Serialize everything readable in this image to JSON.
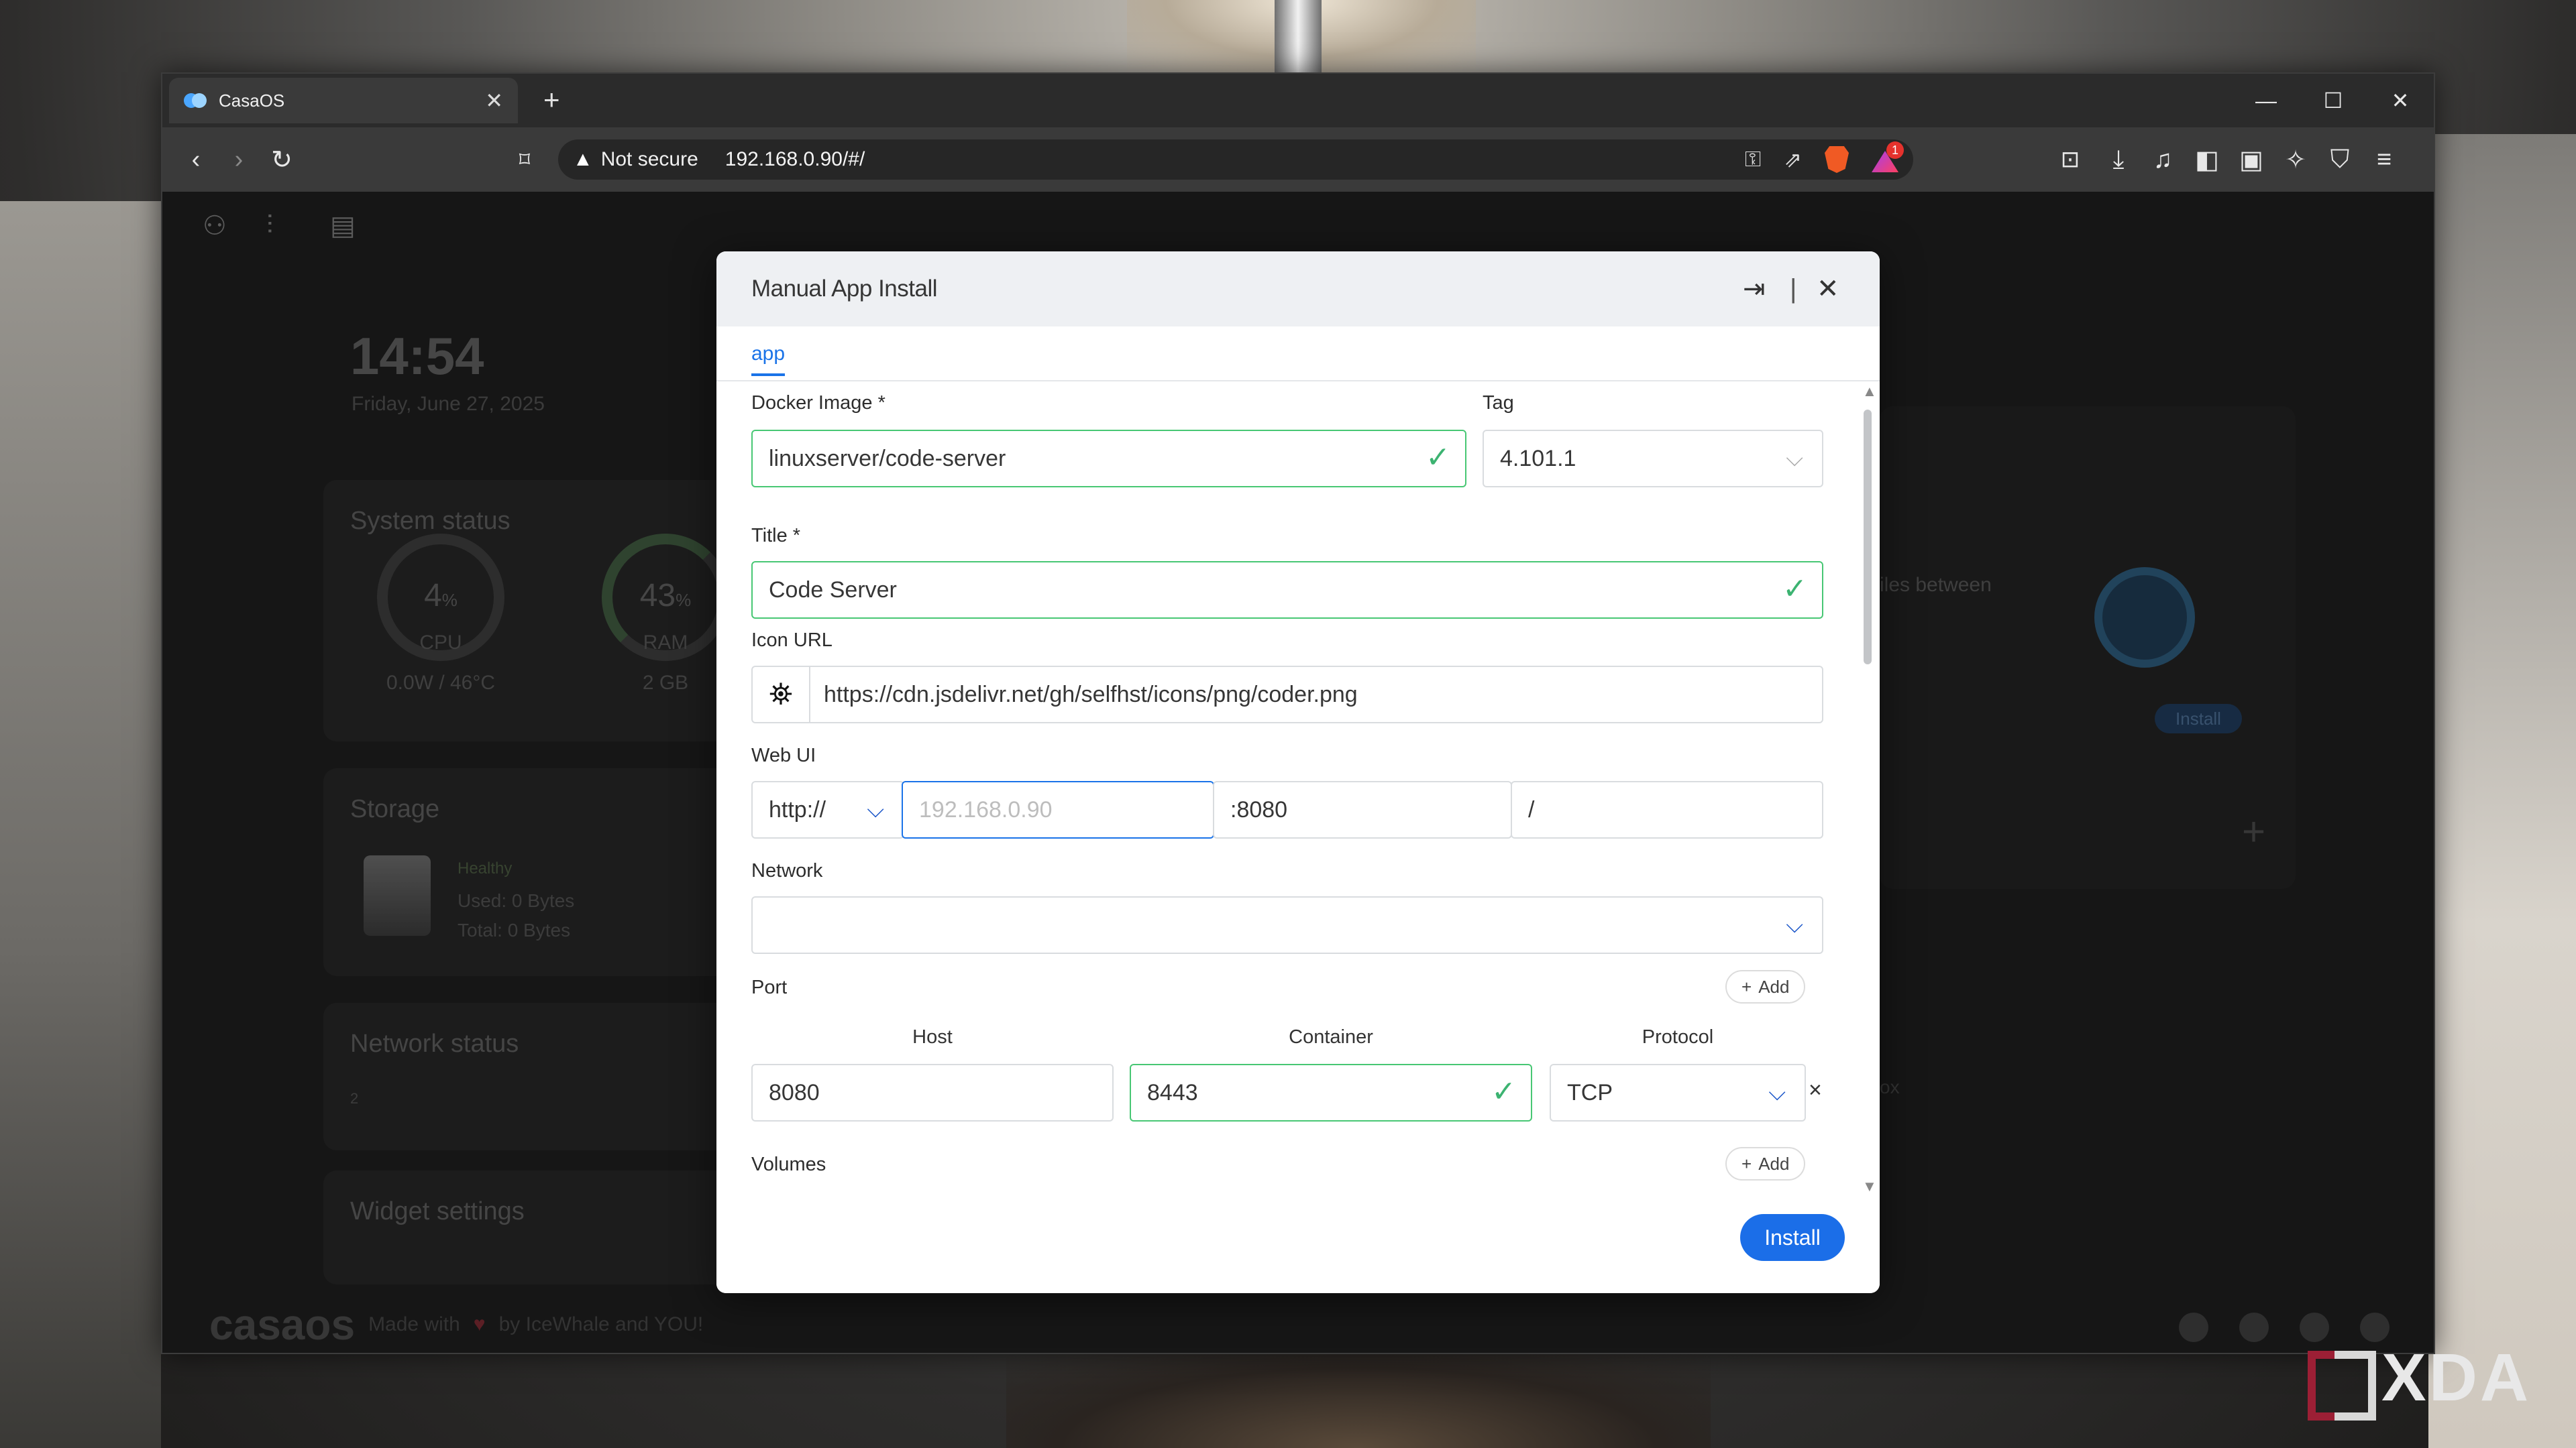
{
  "browser": {
    "tab_title": "CasaOS",
    "new_tab": "+",
    "security_label": "Not secure",
    "url": "192.168.0.90/#/",
    "brave_badge": "1"
  },
  "dashboard": {
    "time": "14:54",
    "date": "Friday, June 27, 2025",
    "system_status_title": "System status",
    "cpu_value": "4",
    "cpu_unit": "%",
    "cpu_label": "CPU",
    "cpu_detail": "0.0W / 46°C",
    "ram_value": "43",
    "ram_unit": "%",
    "ram_label": "RAM",
    "ram_detail": "2 GB",
    "storage_title": "Storage",
    "storage_badge": "Healthy",
    "storage_used": "Used: 0 Bytes",
    "storage_total": "Total: 0 Bytes",
    "network_title": "Network status",
    "network_axis": "2",
    "widget_title": "Widget settings",
    "app_desc_fragment": "iles between",
    "app_install_button": "Install",
    "app_fragment2": "ox",
    "footer_logo": "casaos",
    "footer_made_with": "Made with",
    "footer_by": "by IceWhale and YOU!"
  },
  "modal": {
    "title": "Manual App Install",
    "tab_app": "app",
    "docker_image_label": "Docker Image *",
    "docker_image_value": "linuxserver/code-server",
    "tag_label": "Tag",
    "tag_value": "4.101.1",
    "title_label": "Title *",
    "title_value": "Code Server",
    "icon_url_label": "Icon URL",
    "icon_url_value": "https://cdn.jsdelivr.net/gh/selfhst/icons/png/coder.png",
    "webui_label": "Web UI",
    "webui_scheme": "http://",
    "webui_host_placeholder": "192.168.0.90",
    "webui_port": ":8080",
    "webui_path": "/",
    "network_label": "Network",
    "network_value": "",
    "port_label": "Port",
    "add_label": "Add",
    "port_host_header": "Host",
    "port_container_header": "Container",
    "port_protocol_header": "Protocol",
    "port_host_value": "8080",
    "port_container_value": "8443",
    "port_protocol_value": "TCP",
    "volumes_label": "Volumes",
    "install_button": "Install"
  },
  "watermark": "XDA",
  "icons": [
    "casaos-icon",
    "back-icon",
    "forward-icon",
    "reload-icon",
    "bookmark-icon",
    "warning-icon",
    "key-icon",
    "share-icon",
    "brave-shield-icon",
    "brave-rewards-icon",
    "sidebar-toggle-icon",
    "download-icon",
    "media-icon",
    "split-view-icon",
    "wallet-icon",
    "leo-icon",
    "vpn-icon",
    "menu-icon",
    "import-icon",
    "close-icon",
    "check-icon",
    "chevron-down-icon",
    "plus-icon",
    "remove-icon"
  ],
  "colors": {
    "accent": "#1b6ee8",
    "valid": "#48c774",
    "brave": "#f05a24"
  }
}
